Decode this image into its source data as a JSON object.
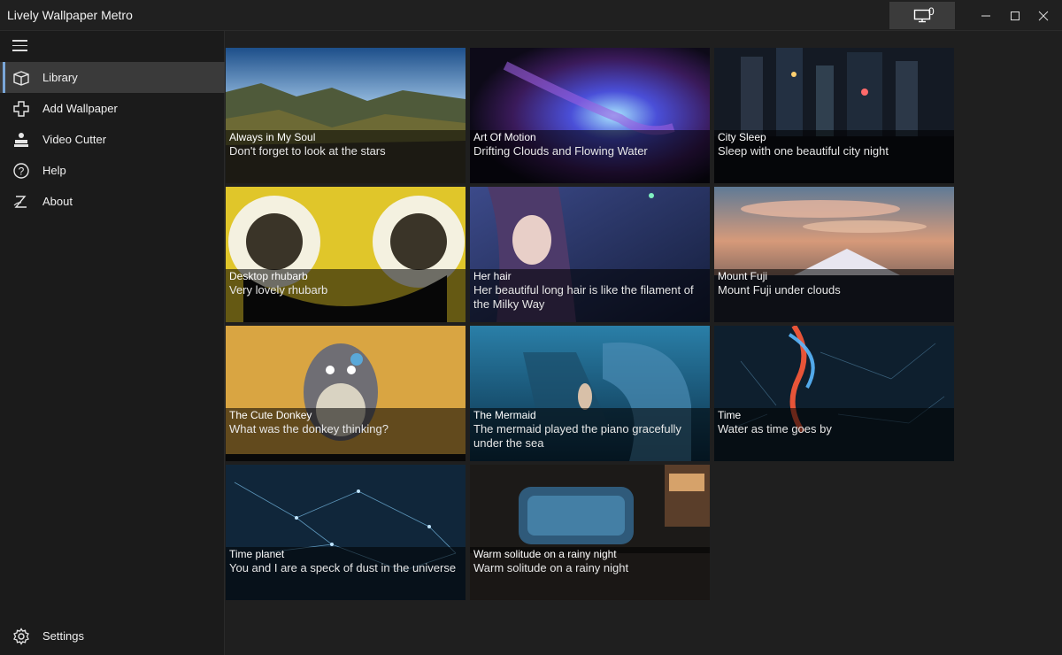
{
  "window": {
    "title": "Lively Wallpaper Metro",
    "monitor_count": "0"
  },
  "sidebar": {
    "items": [
      {
        "label": "Library",
        "icon": "library-icon",
        "active": true
      },
      {
        "label": "Add Wallpaper",
        "icon": "add-icon"
      },
      {
        "label": "Video Cutter",
        "icon": "video-cutter-icon"
      },
      {
        "label": "Help",
        "icon": "help-icon"
      },
      {
        "label": "About",
        "icon": "about-icon"
      }
    ],
    "settings_label": "Settings"
  },
  "library": [
    {
      "title": "Always in My Soul",
      "desc": "Don't forget to look at the stars"
    },
    {
      "title": "Art Of Motion",
      "desc": "Drifting Clouds and Flowing Water"
    },
    {
      "title": "City Sleep",
      "desc": "Sleep with one beautiful city night"
    },
    {
      "title": "Desktop rhubarb",
      "desc": "Very lovely rhubarb"
    },
    {
      "title": "Her hair",
      "desc": "Her beautiful long hair is like the filament of the Milky Way"
    },
    {
      "title": "Mount Fuji",
      "desc": "Mount Fuji under clouds"
    },
    {
      "title": "The Cute Donkey",
      "desc": "What was the donkey thinking?"
    },
    {
      "title": "The Mermaid",
      "desc": "The mermaid played the piano gracefully under the sea"
    },
    {
      "title": "Time",
      "desc": "Water as time goes by"
    },
    {
      "title": "Time planet",
      "desc": "You and I are a speck of dust in the universe"
    },
    {
      "title": "Warm solitude on a rainy night",
      "desc": "Warm solitude on a rainy night"
    }
  ]
}
